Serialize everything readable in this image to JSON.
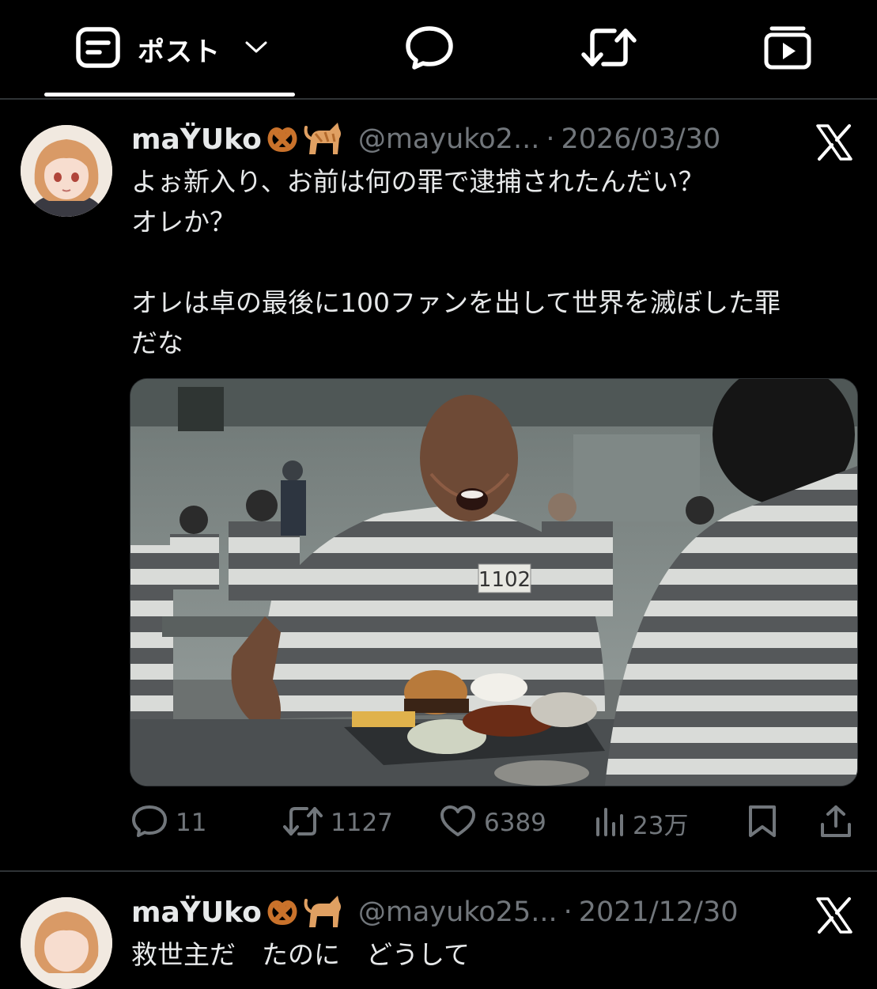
{
  "tabs": {
    "posts_label": "ポスト"
  },
  "posts": [
    {
      "display_name": "maŸUko",
      "handle": "@mayuko2...",
      "separator": "·",
      "date": "2026/03/30",
      "text_lines": [
        "よぉ新入り、お前は何の罪で逮捕されたんだい？",
        "オレか？",
        "",
        "オレは卓の最後に100ファンを出して世界を滅ぼした罪",
        "だな"
      ],
      "media": {
        "badge_number": "1102"
      },
      "stats": {
        "replies": "11",
        "reposts": "1127",
        "likes": "6389",
        "views": "23万"
      }
    },
    {
      "display_name": "maŸUko",
      "handle": "@mayuko25...",
      "separator": "·",
      "date": "2021/12/30",
      "text_partial": "救世主だ　たのに　どうして　"
    }
  ],
  "colors": {
    "background": "#000000",
    "text": "#e7e9ea",
    "muted": "#71767b",
    "divider": "#2f3336"
  },
  "icons": [
    "posts-icon",
    "chevron-down-icon",
    "reply-icon",
    "repost-icon",
    "media-icon",
    "x-logo-icon",
    "pretzel-emoji",
    "cat-emoji",
    "views-icon",
    "bookmark-icon",
    "share-icon"
  ]
}
